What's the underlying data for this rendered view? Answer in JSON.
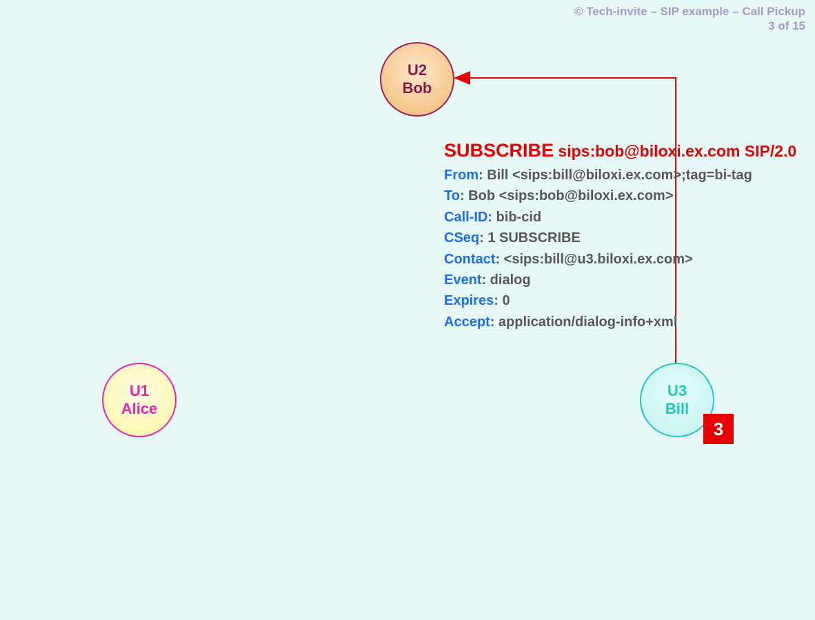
{
  "header": {
    "source": "© Tech-invite – SIP example – Call Pickup",
    "page_indicator": "3 of 15"
  },
  "nodes": {
    "u1": {
      "id": "U1",
      "name": "Alice"
    },
    "u2": {
      "id": "U2",
      "name": "Bob"
    },
    "u3": {
      "id": "U3",
      "name": "Bill"
    }
  },
  "step": {
    "number": "3"
  },
  "arrow": {
    "from": "U3",
    "to": "U2",
    "color": "#e60000"
  },
  "sip_message": {
    "request": {
      "method": "SUBSCRIBE",
      "rest": "sips:bob@biloxi.ex.com SIP/2.0"
    },
    "headers": [
      {
        "name": "From",
        "value": ": Bill <sips:bill@biloxi.ex.com>;tag=bi-tag"
      },
      {
        "name": "To",
        "value": ": Bob <sips:bob@biloxi.ex.com>"
      },
      {
        "name": "Call-ID",
        "value": ": bib-cid"
      },
      {
        "name": "CSeq",
        "value": ": 1 SUBSCRIBE"
      },
      {
        "name": "Contact",
        "value": ": <sips:bill@u3.biloxi.ex.com>"
      },
      {
        "name": "Event",
        "value": ": dialog"
      },
      {
        "name": "Expires",
        "value": ": 0"
      },
      {
        "name": "Accept",
        "value": ": application/dialog-info+xml"
      }
    ]
  }
}
